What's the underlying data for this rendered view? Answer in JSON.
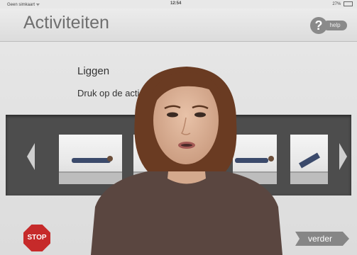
{
  "status_bar": {
    "carrier": "Geen simkaart ᯤ",
    "time": "12:54",
    "battery": "27%"
  },
  "header": {
    "title": "Activiteiten",
    "help_icon": "question-mark-icon",
    "help_label": "help"
  },
  "activity": {
    "title": "Liggen",
    "instruction": "Druk op de acti                               klachten heeft."
  },
  "carousel": {
    "left_arrow_icon": "chevron-left-icon",
    "right_arrow_icon": "chevron-right-icon",
    "thumbnails": [
      {
        "name": "lying-on-back"
      },
      {
        "name": "lying-partial"
      },
      {
        "name": "lying-side"
      },
      {
        "name": "lying-legs-raised"
      }
    ]
  },
  "footer": {
    "stop_label": "STOP",
    "verder_label": "verder"
  },
  "colors": {
    "stop": "#c62a2a",
    "button_gray": "#868686",
    "carousel_bg": "#4d4d4d"
  }
}
